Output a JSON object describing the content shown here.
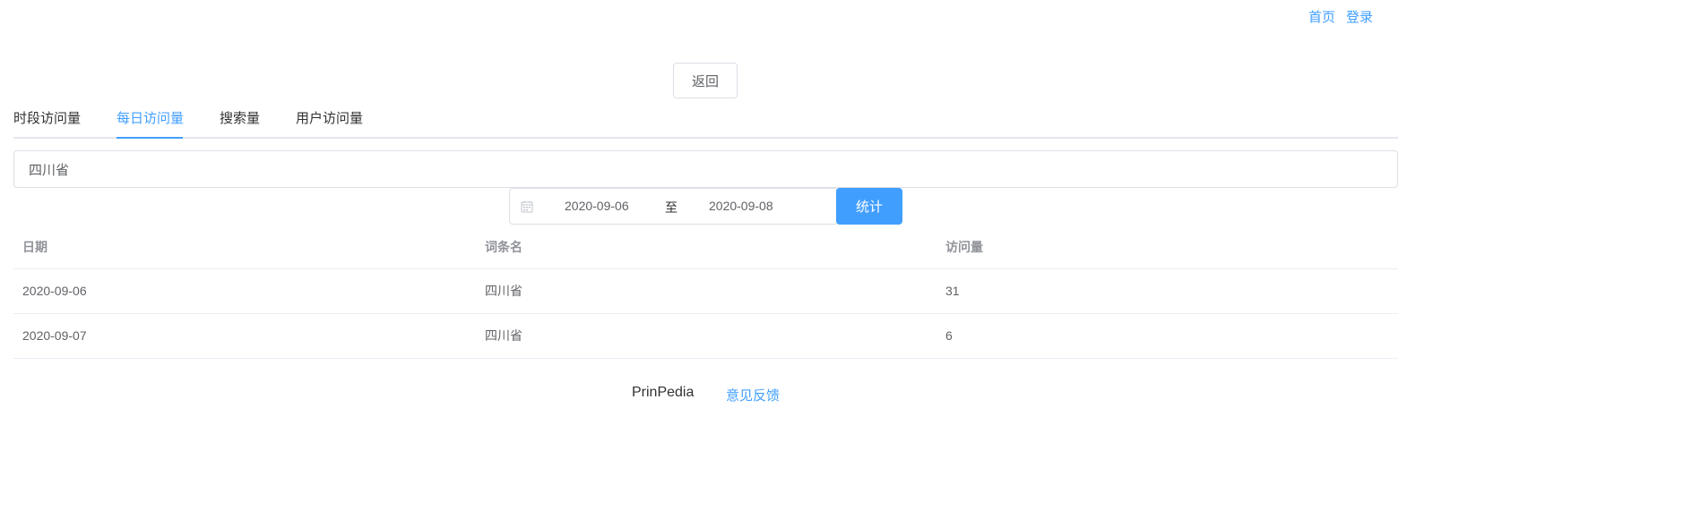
{
  "nav": {
    "home_label": "首页",
    "login_label": "登录"
  },
  "back_button_label": "返回",
  "tabs": [
    {
      "label": "时段访问量",
      "active": false
    },
    {
      "label": "每日访问量",
      "active": true
    },
    {
      "label": "搜索量",
      "active": false
    },
    {
      "label": "用户访问量",
      "active": false
    }
  ],
  "entry_input": {
    "value": "四川省"
  },
  "date_range": {
    "icon": "calendar-icon",
    "start": "2020-09-06",
    "separator": "至",
    "end": "2020-09-08"
  },
  "stat_button_label": "统计",
  "table": {
    "headers": [
      "日期",
      "词条名",
      "访问量"
    ],
    "rows": [
      [
        "2020-09-06",
        "四川省",
        "31"
      ],
      [
        "2020-09-07",
        "四川省",
        "6"
      ]
    ]
  },
  "footer": {
    "brand": "PrinPedia",
    "feedback_label": "意见反馈"
  },
  "colors": {
    "accent": "#409eff",
    "border": "#dcdfe6",
    "text": "#303133",
    "muted": "#909399"
  }
}
